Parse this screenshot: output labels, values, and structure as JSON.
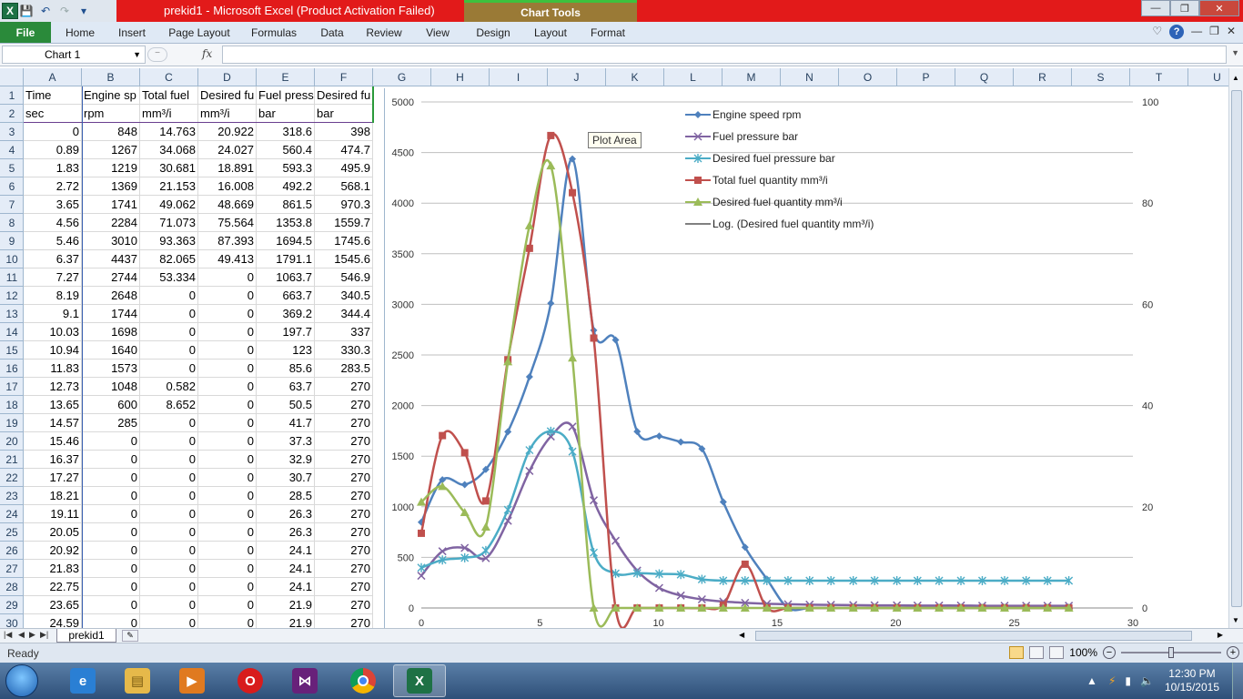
{
  "window": {
    "title": "prekid1  -  Microsoft Excel (Product Activation Failed)",
    "context_tab": "Chart Tools",
    "controls": {
      "minimize": "—",
      "restore": "❐",
      "close": "✕"
    }
  },
  "ribbon": {
    "tabs": [
      {
        "label": "File"
      },
      {
        "label": "Home"
      },
      {
        "label": "Insert"
      },
      {
        "label": "Page Layout"
      },
      {
        "label": "Formulas"
      },
      {
        "label": "Data"
      },
      {
        "label": "Review"
      },
      {
        "label": "View"
      },
      {
        "label": "Design"
      },
      {
        "label": "Layout"
      },
      {
        "label": "Format"
      }
    ],
    "help": "?"
  },
  "formula_bar": {
    "name_box": "Chart 1",
    "fx": "fx",
    "value": ""
  },
  "sheet": {
    "columns": [
      "A",
      "B",
      "C",
      "D",
      "E",
      "F",
      "G",
      "H",
      "I",
      "J",
      "K",
      "L",
      "M",
      "N",
      "O",
      "P",
      "Q",
      "R",
      "S",
      "T",
      "U"
    ],
    "row_numbers": [
      "1",
      "2",
      "3",
      "4",
      "5",
      "6",
      "7",
      "8",
      "9",
      "10",
      "11",
      "12",
      "13",
      "14",
      "15",
      "16",
      "17",
      "18",
      "19",
      "20",
      "21",
      "22",
      "23",
      "24",
      "25",
      "26",
      "27",
      "28",
      "29",
      "30"
    ],
    "rows": [
      [
        "Time",
        "Engine sp",
        "Total fuel",
        "Desired fu",
        "Fuel press",
        "Desired fu"
      ],
      [
        "sec",
        "rpm",
        "mm³/i",
        "mm³/i",
        "bar",
        "bar"
      ],
      [
        "0",
        "848",
        "14.763",
        "20.922",
        "318.6",
        "398"
      ],
      [
        "0.89",
        "1267",
        "34.068",
        "24.027",
        "560.4",
        "474.7"
      ],
      [
        "1.83",
        "1219",
        "30.681",
        "18.891",
        "593.3",
        "495.9"
      ],
      [
        "2.72",
        "1369",
        "21.153",
        "16.008",
        "492.2",
        "568.1"
      ],
      [
        "3.65",
        "1741",
        "49.062",
        "48.669",
        "861.5",
        "970.3"
      ],
      [
        "4.56",
        "2284",
        "71.073",
        "75.564",
        "1353.8",
        "1559.7"
      ],
      [
        "5.46",
        "3010",
        "93.363",
        "87.393",
        "1694.5",
        "1745.6"
      ],
      [
        "6.37",
        "4437",
        "82.065",
        "49.413",
        "1791.1",
        "1545.6"
      ],
      [
        "7.27",
        "2744",
        "53.334",
        "0",
        "1063.7",
        "546.9"
      ],
      [
        "8.19",
        "2648",
        "0",
        "0",
        "663.7",
        "340.5"
      ],
      [
        "9.1",
        "1744",
        "0",
        "0",
        "369.2",
        "344.4"
      ],
      [
        "10.03",
        "1698",
        "0",
        "0",
        "197.7",
        "337"
      ],
      [
        "10.94",
        "1640",
        "0",
        "0",
        "123",
        "330.3"
      ],
      [
        "11.83",
        "1573",
        "0",
        "0",
        "85.6",
        "283.5"
      ],
      [
        "12.73",
        "1048",
        "0.582",
        "0",
        "63.7",
        "270"
      ],
      [
        "13.65",
        "600",
        "8.652",
        "0",
        "50.5",
        "270"
      ],
      [
        "14.57",
        "285",
        "0",
        "0",
        "41.7",
        "270"
      ],
      [
        "15.46",
        "0",
        "0",
        "0",
        "37.3",
        "270"
      ],
      [
        "16.37",
        "0",
        "0",
        "0",
        "32.9",
        "270"
      ],
      [
        "17.27",
        "0",
        "0",
        "0",
        "30.7",
        "270"
      ],
      [
        "18.21",
        "0",
        "0",
        "0",
        "28.5",
        "270"
      ],
      [
        "19.11",
        "0",
        "0",
        "0",
        "26.3",
        "270"
      ],
      [
        "20.05",
        "0",
        "0",
        "0",
        "26.3",
        "270"
      ],
      [
        "20.92",
        "0",
        "0",
        "0",
        "24.1",
        "270"
      ],
      [
        "21.83",
        "0",
        "0",
        "0",
        "24.1",
        "270"
      ],
      [
        "22.75",
        "0",
        "0",
        "0",
        "24.1",
        "270"
      ],
      [
        "23.65",
        "0",
        "0",
        "0",
        "21.9",
        "270"
      ],
      [
        "24.59",
        "0",
        "0",
        "0",
        "21.9",
        "270"
      ]
    ],
    "tab_name": "prekid1"
  },
  "chart_data": {
    "type": "line",
    "title": "",
    "xlabel": "",
    "ylabel": "",
    "xlim": [
      0,
      30
    ],
    "ylim": [
      0,
      5000
    ],
    "y2lim": [
      0,
      100
    ],
    "x_ticks": [
      "0",
      "5",
      "10",
      "15",
      "20",
      "25",
      "30"
    ],
    "y_ticks": [
      "0",
      "500",
      "1000",
      "1500",
      "2000",
      "2500",
      "3000",
      "3500",
      "4000",
      "4500",
      "5000"
    ],
    "y2_ticks": [
      "0",
      "20",
      "40",
      "60",
      "80",
      "100"
    ],
    "grid": true,
    "legend_position": "top-center",
    "x": [
      0,
      0.89,
      1.83,
      2.72,
      3.65,
      4.56,
      5.46,
      6.37,
      7.27,
      8.19,
      9.1,
      10.03,
      10.94,
      11.83,
      12.73,
      13.65,
      14.57,
      15.46,
      16.37,
      17.27,
      18.21,
      19.11,
      20.05,
      20.92,
      21.83,
      22.75,
      23.65,
      24.59,
      25.5,
      26.4,
      27.3
    ],
    "series": [
      {
        "name": "Engine speed rpm",
        "axis": "left",
        "color": "#4f81bd",
        "marker": "diamond",
        "values": [
          848,
          1267,
          1219,
          1369,
          1741,
          2284,
          3010,
          4437,
          2744,
          2648,
          1744,
          1698,
          1640,
          1573,
          1048,
          600,
          285,
          0,
          0,
          0,
          0,
          0,
          0,
          0,
          0,
          0,
          0,
          0,
          0,
          0,
          0
        ]
      },
      {
        "name": "Fuel pressure bar",
        "axis": "left",
        "color": "#8064a2",
        "marker": "x",
        "values": [
          318.6,
          560.4,
          593.3,
          492.2,
          861.5,
          1353.8,
          1694.5,
          1791.1,
          1063.7,
          663.7,
          369.2,
          197.7,
          123,
          85.6,
          63.7,
          50.5,
          41.7,
          37.3,
          32.9,
          30.7,
          28.5,
          26.3,
          26.3,
          24.1,
          24.1,
          24.1,
          21.9,
          21.9,
          21.9,
          21.9,
          21.9
        ]
      },
      {
        "name": "Desired fuel pressure bar",
        "axis": "left",
        "color": "#4bacc6",
        "marker": "star",
        "values": [
          398,
          474.7,
          495.9,
          568.1,
          970.3,
          1559.7,
          1745.6,
          1545.6,
          546.9,
          340.5,
          344.4,
          337,
          330.3,
          283.5,
          270,
          270,
          270,
          270,
          270,
          270,
          270,
          270,
          270,
          270,
          270,
          270,
          270,
          270,
          270,
          270,
          270
        ]
      },
      {
        "name": "Total fuel quantity mm³/i",
        "axis": "right",
        "color": "#c0504d",
        "marker": "square",
        "values": [
          14.763,
          34.068,
          30.681,
          21.153,
          49.062,
          71.073,
          93.363,
          82.065,
          53.334,
          0,
          0,
          0,
          0,
          0,
          0.582,
          8.652,
          0,
          0,
          0,
          0,
          0,
          0,
          0,
          0,
          0,
          0,
          0,
          0,
          0,
          0,
          0
        ]
      },
      {
        "name": "Desired fuel quantity mm³/i",
        "axis": "right",
        "color": "#9bbb59",
        "marker": "triangle",
        "values": [
          20.922,
          24.027,
          18.891,
          16.008,
          48.669,
          75.564,
          87.393,
          49.413,
          0,
          0,
          0,
          0,
          0,
          0,
          0,
          0,
          0,
          0,
          0,
          0,
          0,
          0,
          0,
          0,
          0,
          0,
          0,
          0,
          0,
          0,
          0
        ]
      },
      {
        "name": "Log. (Desired fuel quantity mm³/i)",
        "axis": "right",
        "color": "#000000",
        "marker": "none",
        "trendline": true,
        "values": []
      }
    ],
    "tooltip": "Plot Area"
  },
  "status": {
    "ready": "Ready",
    "zoom": "100%"
  },
  "taskbar": {
    "time": "12:30 PM",
    "date": "10/15/2015",
    "apps": [
      {
        "icon": "internet-explorer-icon"
      },
      {
        "icon": "file-explorer-icon"
      },
      {
        "icon": "media-player-icon"
      },
      {
        "icon": "opera-icon"
      },
      {
        "icon": "visual-studio-icon"
      },
      {
        "icon": "chrome-icon"
      },
      {
        "icon": "excel-icon"
      }
    ]
  }
}
